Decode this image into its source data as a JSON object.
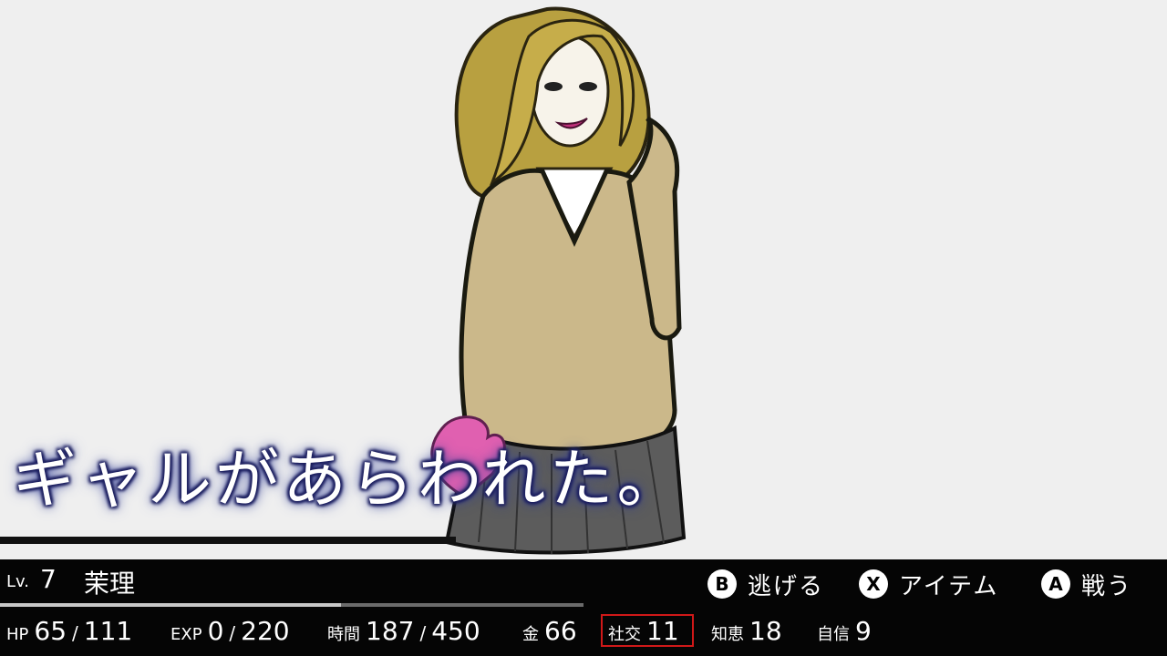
{
  "message": "ギャルがあらわれた。",
  "enemy": {
    "image": "gal-schoolgirl-illustration"
  },
  "player": {
    "level_label": "Lv.",
    "level": "7",
    "name": "茉理",
    "exp_progress": 0.585
  },
  "commands": [
    {
      "key": "B",
      "label": "逃げる"
    },
    {
      "key": "X",
      "label": "アイテム"
    },
    {
      "key": "A",
      "label": "戦う"
    }
  ],
  "stats": {
    "hp": {
      "label": "HP",
      "current": "65",
      "sep": "/",
      "max": "111"
    },
    "exp": {
      "label": "EXP",
      "current": "0",
      "sep": "/",
      "max": "220"
    },
    "time": {
      "label": "時間",
      "current": "187",
      "sep": "/",
      "max": "450"
    },
    "money": {
      "label": "金",
      "value": "66"
    },
    "social": {
      "label": "社交",
      "value": "11",
      "highlight_color": "#d01818"
    },
    "wisdom": {
      "label": "知恵",
      "value": "18"
    },
    "confidence": {
      "label": "自信",
      "value": "9"
    }
  }
}
